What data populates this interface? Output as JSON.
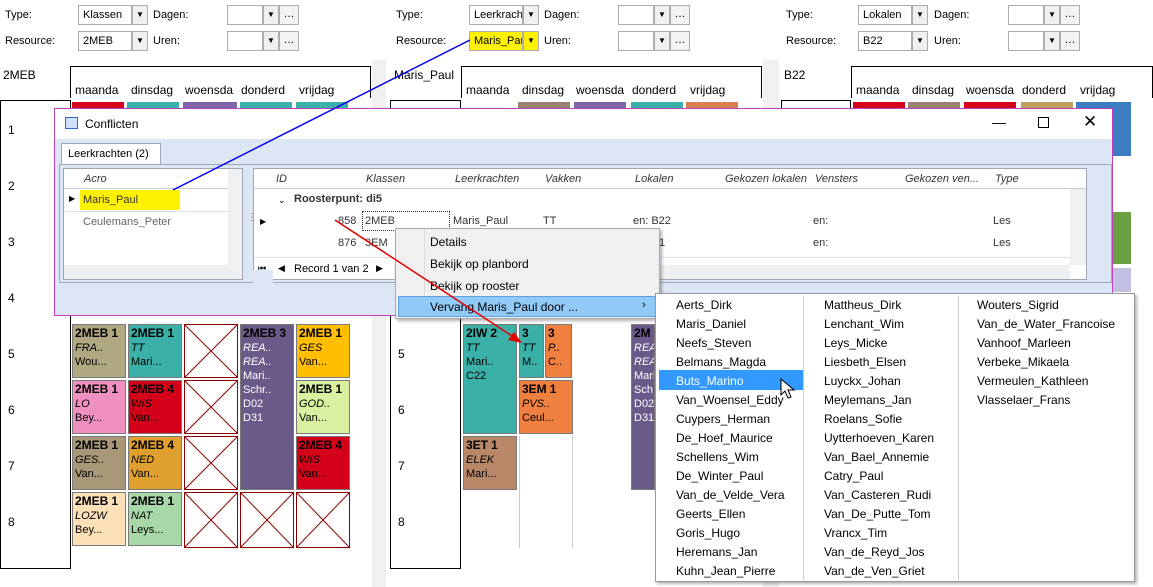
{
  "panels": [
    {
      "type_label": "Type:",
      "type_value": "Klassen",
      "dagen_label": "Dagen:",
      "resource_label": "Resource:",
      "resource_value": "2MEB",
      "uren_label": "Uren:",
      "title": "2MEB"
    },
    {
      "type_label": "Type:",
      "type_value": "Leerkrachten",
      "dagen_label": "Dagen:",
      "resource_label": "Resource:",
      "resource_value": "Maris_Paul",
      "uren_label": "Uren:",
      "title": "Maris_Paul"
    },
    {
      "type_label": "Type:",
      "type_value": "Lokalen",
      "dagen_label": "Dagen:",
      "resource_label": "Resource:",
      "resource_value": "B22",
      "uren_label": "Uren:",
      "title": "B22"
    }
  ],
  "days": [
    "maanda",
    "dinsdag",
    "woensda",
    "donderd",
    "vrijdag"
  ],
  "hours": [
    "1",
    "2",
    "3",
    "4",
    "5",
    "6",
    "7",
    "8"
  ],
  "lessons": {
    "l1": [
      "2MEB",
      "1",
      "FRA..",
      "Wou..."
    ],
    "l2": [
      "2MEB",
      "1",
      "TT",
      "Mari..."
    ],
    "l3": [
      "2MEB",
      "3",
      "REA..",
      "REA..",
      "Mari..",
      "Schr..",
      "D02",
      "D31"
    ],
    "l4": [
      "2MEB",
      "1",
      "GES",
      "Van..."
    ],
    "l5": [
      "2MEB",
      "1",
      "LO",
      "Bey..."
    ],
    "l6": [
      "2MEB",
      "4",
      "WIS",
      "Van..."
    ],
    "l7": [
      "2MEB",
      "1",
      "GOD..",
      "Van..."
    ],
    "l8": [
      "2MEB",
      "1",
      "GES..",
      "Van..."
    ],
    "l9": [
      "2MEB",
      "4",
      "NED",
      "Van..."
    ],
    "l10": [
      "2MEB",
      "4",
      "WIS",
      "Van..."
    ],
    "l11": [
      "2MEB",
      "1",
      "LOZW",
      "Bey..."
    ],
    "l12": [
      "2MEB",
      "1",
      "NAT",
      "Leys..."
    ],
    "m1": [
      "2IW",
      "2",
      "TT",
      "Mari..",
      "C22"
    ],
    "m2": [
      "3",
      "TT",
      "M.."
    ],
    "m3": [
      "3",
      "P..",
      "C.."
    ],
    "m4": [
      "3EM",
      "1",
      "PVS..",
      "Ceul..."
    ],
    "m5": [
      "3ET",
      "1",
      "ELEK",
      "Mari..."
    ],
    "m6": [
      "2M",
      "REA",
      "REA",
      "Mari",
      "Sch",
      "D02",
      "D31"
    ]
  },
  "dialog": {
    "title": "Conflicten",
    "tab": "Leerkrachten (2)",
    "left_header": "Acro",
    "left_rows": [
      "Maris_Paul",
      "Ceulemans_Peter"
    ],
    "columns": [
      "ID",
      "Klassen",
      "Leerkrachten",
      "Vakken",
      "Lokalen",
      "Gekozen lokalen",
      "Vensters",
      "Gekozen ven...",
      "Type"
    ],
    "group": "Roosterpunt: di5",
    "rows": [
      {
        "id": "858",
        "klas": "2MEB",
        "lk": "Maris_Paul",
        "vak": "TT",
        "lok": "en: B22",
        "venst": "en:",
        "type": "Les"
      },
      {
        "id": "876",
        "klas": "3EM",
        "lk": "",
        "vak": "",
        "lok": "1",
        "venst": "en:",
        "type": "Les"
      }
    ],
    "record": "Record 1 van 2"
  },
  "menu": [
    "Details",
    "Bekijk op planbord",
    "Bekijk op rooster",
    "Vervang Maris_Paul door ..."
  ],
  "names": [
    [
      "Aerts_Dirk",
      "Maris_Daniel",
      "Neefs_Steven",
      "Belmans_Magda",
      "Buts_Marino",
      "Van_Woensel_Eddy",
      "Cuypers_Herman",
      "De_Hoef_Maurice",
      "Schellens_Wim",
      "De_Winter_Paul",
      "Van_de_Velde_Vera",
      "Geerts_Ellen",
      "Goris_Hugo",
      "Heremans_Jan",
      "Kuhn_Jean_Pierre"
    ],
    [
      "Mattheus_Dirk",
      "Lenchant_Wim",
      "Leys_Micke",
      "Liesbeth_Elsen",
      "Luyckx_Johan",
      "Meylemans_Jan",
      "Roelans_Sofie",
      "Uytterhoeven_Karen",
      "Van_Bael_Annemie",
      "Catry_Paul",
      "Van_Casteren_Rudi",
      "Van_De_Putte_Tom",
      "Vrancx_Tim",
      "Van_de_Reyd_Jos",
      "Van_de_Ven_Griet"
    ],
    [
      "Wouters_Sigrid",
      "Van_de_Water_Francoise",
      "Vanhoof_Marleen",
      "Verbeke_Mikaela",
      "Vermeulen_Kathleen",
      "Vlasselaer_Frans"
    ]
  ],
  "colors": {
    "highlight": "#fff200",
    "selected": "#3399ff",
    "arrow_blue": "#0000ee",
    "arrow_red": "#e00000"
  }
}
